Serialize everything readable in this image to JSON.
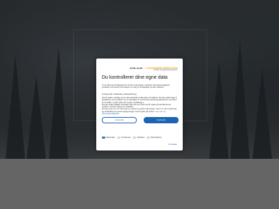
{
  "logo": {
    "main": "arla.com",
    "separator": "/",
    "accent": "COOKIEINFORMATION",
    "subtitle": "Cookie management platform"
  },
  "dialog": {
    "title": "Du kontrollerer dine egne data",
    "para1": "Vi og våre forretningspartnere bruker teknologier, inkludert informasjonskapsler (cookies) til å samle informasjon om deg for forskjellige formål, inkludert:",
    "purposes": "Funksjonelle, Statistiske, Markedsføring",
    "para2": "Ved å trykke «Godta» gir du ditt samtykke til alle disse formålene. Du kan også velge å spesifisere de formålene du vil samtykke til ved å bruke avkrysningsboksene ved siden av formålet, og så trykke på «Lagre innstillinger».",
    "para3": "Du kan trekke tilbake samtykket ditt når som helst ved å trykke på det lille ikonet nederst i venstre hjørne av nettsiden.",
    "para4": "Du kan lese mer om vår bruk av cookies og andre teknologier, samt om vår innsamling og behandling av personopplysninger ved å trykke på lenken.",
    "link": "Les mer om informasjonskapsler",
    "reject_label": "Avvis alle",
    "accept_label": "Godta alle",
    "toggles": [
      {
        "label": "Nødvendige",
        "on": true
      },
      {
        "label": "Funksjonelle",
        "on": false
      },
      {
        "label": "Statistiske",
        "on": false
      },
      {
        "label": "Markedsføring",
        "on": false
      }
    ],
    "footer_link": "Vis detaljer"
  }
}
